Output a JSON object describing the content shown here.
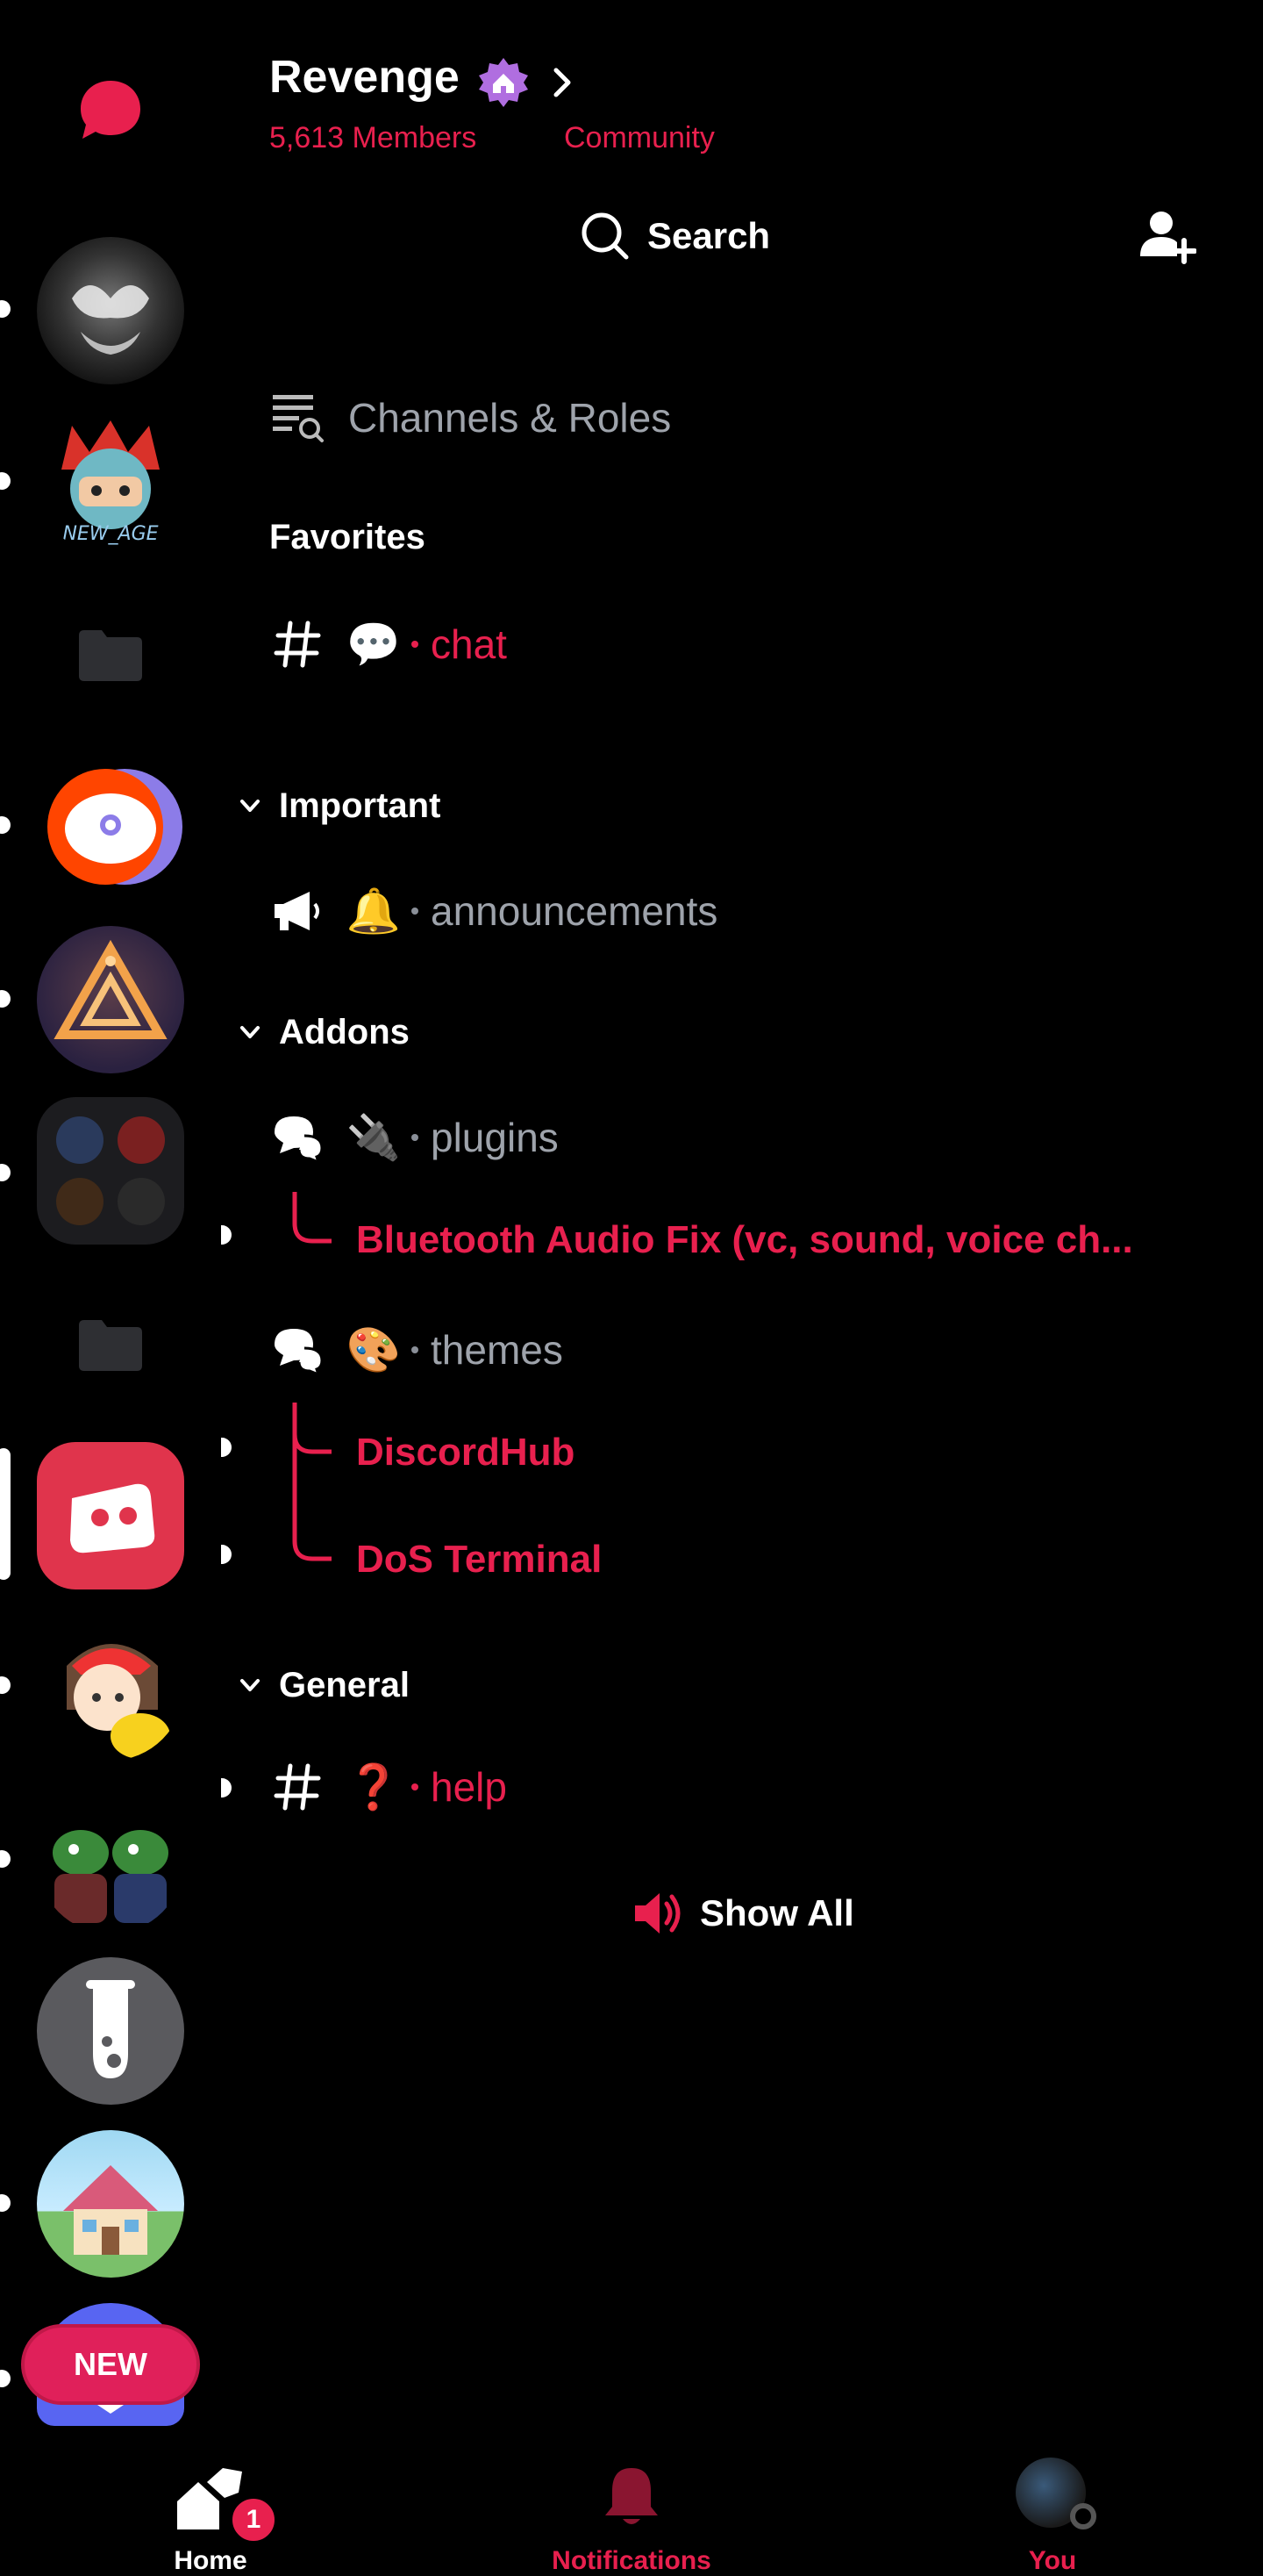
{
  "header": {
    "server_name": "Revenge",
    "members": "5,613 Members",
    "community": "Community",
    "search_label": "Search"
  },
  "channels_roles": "Channels & Roles",
  "favorites": {
    "heading": "Favorites",
    "items": [
      {
        "emoji": "💬",
        "name": "chat"
      }
    ]
  },
  "categories": [
    {
      "name": "Important",
      "channels": [
        {
          "emoji": "🔔",
          "name": "announcements"
        }
      ]
    },
    {
      "name": "Addons",
      "channels": [
        {
          "emoji": "🔌",
          "name": "plugins",
          "threads": [
            "Bluetooth Audio Fix (vc, sound, voice ch..."
          ]
        },
        {
          "emoji": "🎨",
          "name": "themes",
          "threads": [
            "DiscordHub",
            "DoS Terminal"
          ]
        }
      ]
    },
    {
      "name": "General",
      "channels": [
        {
          "emoji": "❓",
          "name": "help"
        }
      ]
    }
  ],
  "show_all": "Show All",
  "new_badge": "NEW",
  "bottom_nav": {
    "home": "Home",
    "home_badge": "1",
    "notifications": "Notifications",
    "you": "You"
  },
  "colors": {
    "accent": "#e8204e",
    "muted": "#9ea3ab",
    "background": "#000000"
  }
}
